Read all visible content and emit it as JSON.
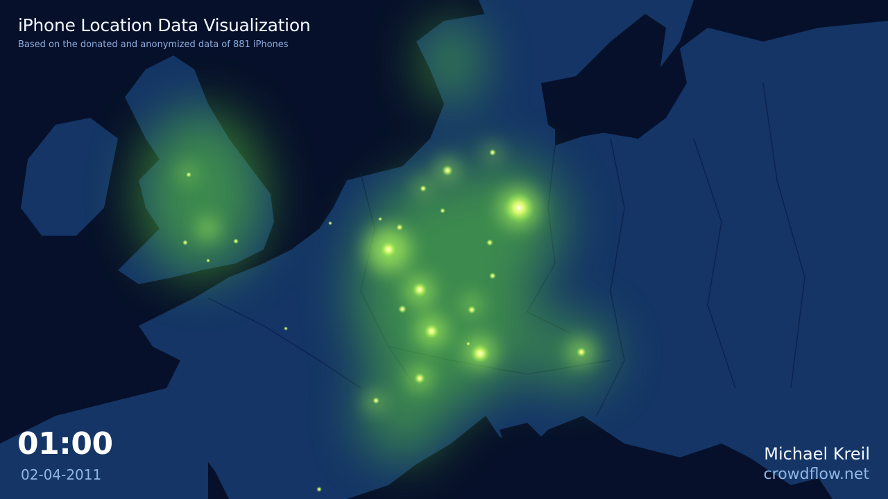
{
  "header": {
    "title": "iPhone Location Data Visualization",
    "subtitle": "Based on the donated and anonymized data of 881 iPhones"
  },
  "timestamp": {
    "time": "01:00",
    "date": "02-04-2011"
  },
  "credits": {
    "author": "Michael Kreil",
    "site": "crowdflow.net"
  },
  "colors": {
    "ocean": "#06102a",
    "land": "#143566",
    "border": "#0c2350",
    "glow": "#9cff5a",
    "hotspot": "#ffff9a"
  }
}
